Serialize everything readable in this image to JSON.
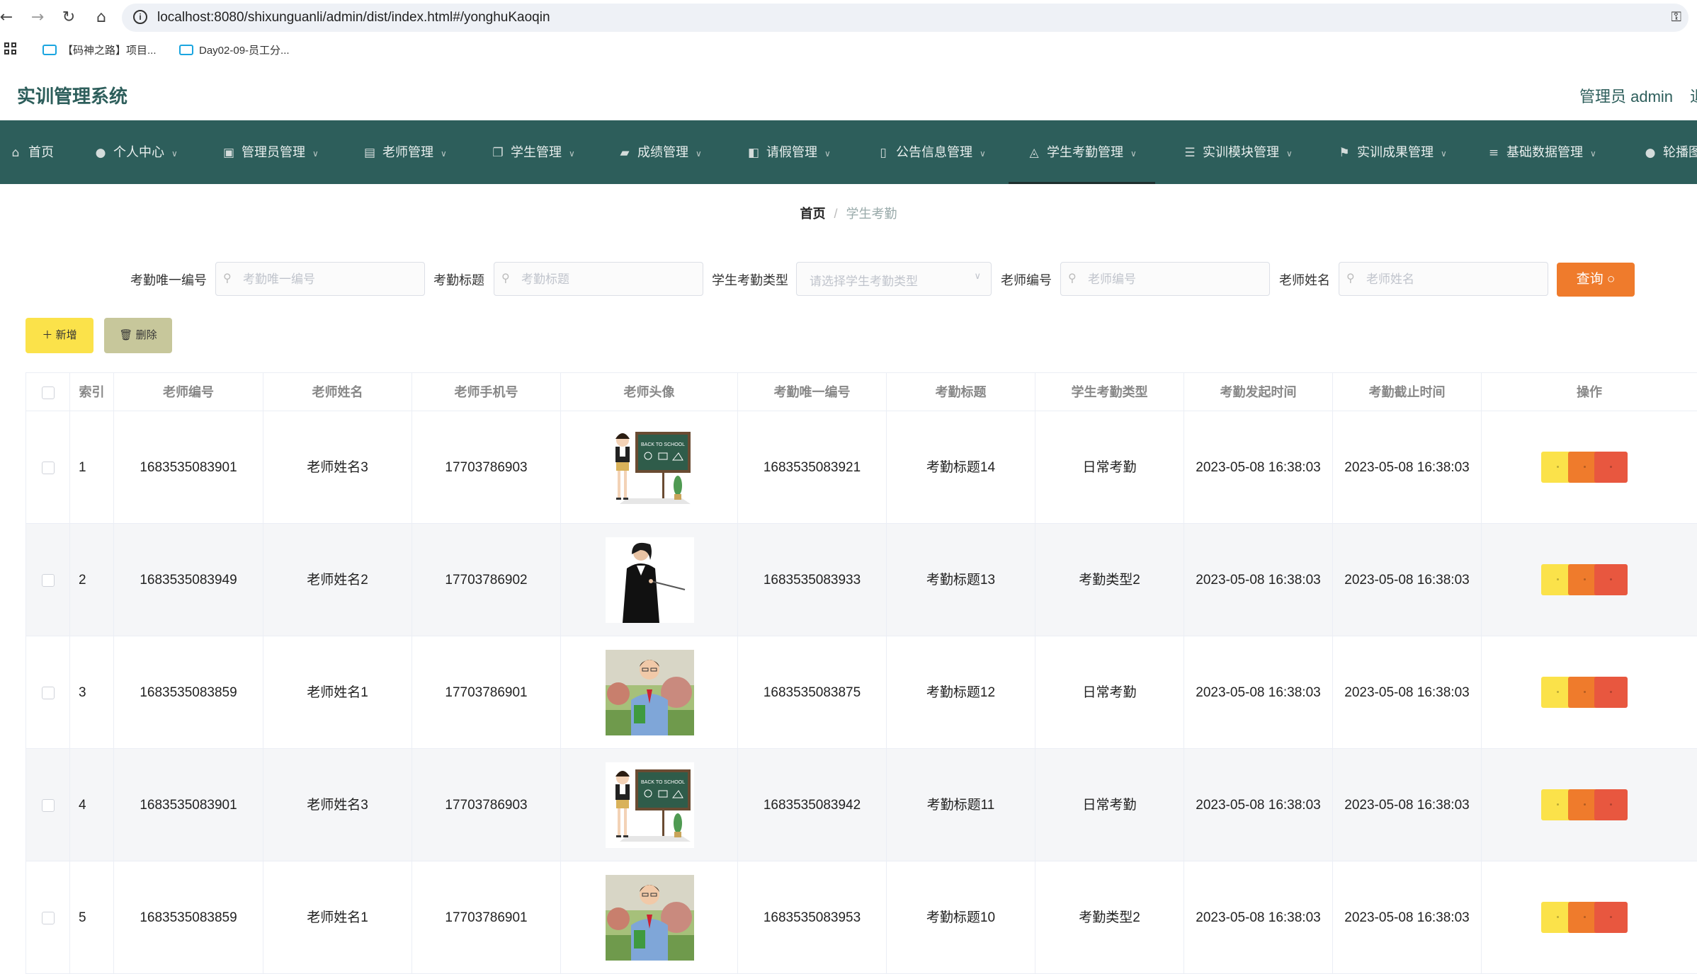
{
  "browser": {
    "url": "localhost:8080/shixunguanli/admin/dist/index.html#/yonghuKaoqin",
    "bookmarks": [
      "【码神之路】项目...",
      "Day02-09-员工分..."
    ]
  },
  "app": {
    "title": "实训管理系统",
    "user": "管理员 admin",
    "logout": "退"
  },
  "nav": [
    {
      "label": "首页",
      "icon": "home-icon",
      "glyph": "⌂",
      "chev": false
    },
    {
      "label": "个人中心",
      "icon": "user-icon",
      "glyph": "●",
      "chev": true
    },
    {
      "label": "管理员管理",
      "icon": "briefcase-icon",
      "glyph": "▣",
      "chev": true
    },
    {
      "label": "老师管理",
      "icon": "clipboard-icon",
      "glyph": "▤",
      "chev": true
    },
    {
      "label": "学生管理",
      "icon": "copy-icon",
      "glyph": "❐",
      "chev": true
    },
    {
      "label": "成绩管理",
      "icon": "ticket-icon",
      "glyph": "▰",
      "chev": true
    },
    {
      "label": "请假管理",
      "icon": "cart-icon",
      "glyph": "◧",
      "chev": true
    },
    {
      "label": "公告信息管理",
      "icon": "mic-icon",
      "glyph": "▯",
      "chev": true
    },
    {
      "label": "学生考勤管理",
      "icon": "bell-off-icon",
      "glyph": "◬",
      "chev": true
    },
    {
      "label": "实训模块管理",
      "icon": "list-icon",
      "glyph": "☰",
      "chev": true
    },
    {
      "label": "实训成果管理",
      "icon": "flag-icon",
      "glyph": "⚑",
      "chev": true
    },
    {
      "label": "基础数据管理",
      "icon": "sliders-icon",
      "glyph": "≡",
      "chev": true
    },
    {
      "label": "轮播图",
      "icon": "user-icon",
      "glyph": "●",
      "chev": false
    }
  ],
  "breadcrumb": {
    "home": "首页",
    "sep": "/",
    "current": "学生考勤"
  },
  "search": {
    "kaoqin_no": {
      "label": "考勤唯一编号",
      "placeholder": "考勤唯一编号"
    },
    "kaoqin_title": {
      "label": "考勤标题",
      "placeholder": "考勤标题"
    },
    "kaoqin_type": {
      "label": "学生考勤类型",
      "placeholder": "请选择学生考勤类型"
    },
    "teacher_no": {
      "label": "老师编号",
      "placeholder": "老师编号"
    },
    "teacher_name": {
      "label": "老师姓名",
      "placeholder": "老师姓名"
    },
    "query_button": "查询 ○"
  },
  "actions": {
    "add": "＋ 新增",
    "delete": "🗑 删除"
  },
  "table": {
    "headers": [
      "",
      "索引",
      "老师编号",
      "老师姓名",
      "老师手机号",
      "老师头像",
      "考勤唯一编号",
      "考勤标题",
      "学生考勤类型",
      "考勤发起时间",
      "考勤截止时间",
      "操作"
    ],
    "rows": [
      {
        "index": "1",
        "teacher_no": "1683535083901",
        "teacher_name": "老师姓名3",
        "phone": "17703786903",
        "avatar": "teacher-chalkboard",
        "kaoqin_no": "1683535083921",
        "title": "考勤标题14",
        "type": "日常考勤",
        "start": "2023-05-08 16:38:03",
        "end": "2023-05-08 16:38:03"
      },
      {
        "index": "2",
        "teacher_no": "1683535083949",
        "teacher_name": "老师姓名2",
        "phone": "17703786902",
        "avatar": "teacher-pointer",
        "kaoqin_no": "1683535083933",
        "title": "考勤标题13",
        "type": "考勤类型2",
        "start": "2023-05-08 16:38:03",
        "end": "2023-05-08 16:38:03"
      },
      {
        "index": "3",
        "teacher_no": "1683535083859",
        "teacher_name": "老师姓名1",
        "phone": "17703786901",
        "avatar": "teacher-outdoor",
        "kaoqin_no": "1683535083875",
        "title": "考勤标题12",
        "type": "日常考勤",
        "start": "2023-05-08 16:38:03",
        "end": "2023-05-08 16:38:03"
      },
      {
        "index": "4",
        "teacher_no": "1683535083901",
        "teacher_name": "老师姓名3",
        "phone": "17703786903",
        "avatar": "teacher-chalkboard",
        "kaoqin_no": "1683535083942",
        "title": "考勤标题11",
        "type": "日常考勤",
        "start": "2023-05-08 16:38:03",
        "end": "2023-05-08 16:38:03"
      },
      {
        "index": "5",
        "teacher_no": "1683535083859",
        "teacher_name": "老师姓名1",
        "phone": "17703786901",
        "avatar": "teacher-outdoor",
        "kaoqin_no": "1683535083953",
        "title": "考勤标题10",
        "type": "考勤类型2",
        "start": "2023-05-08 16:38:03",
        "end": "2023-05-08 16:38:03"
      }
    ],
    "op_colors": [
      "#fbe24a",
      "#ef7b2c",
      "#e8573f"
    ]
  }
}
